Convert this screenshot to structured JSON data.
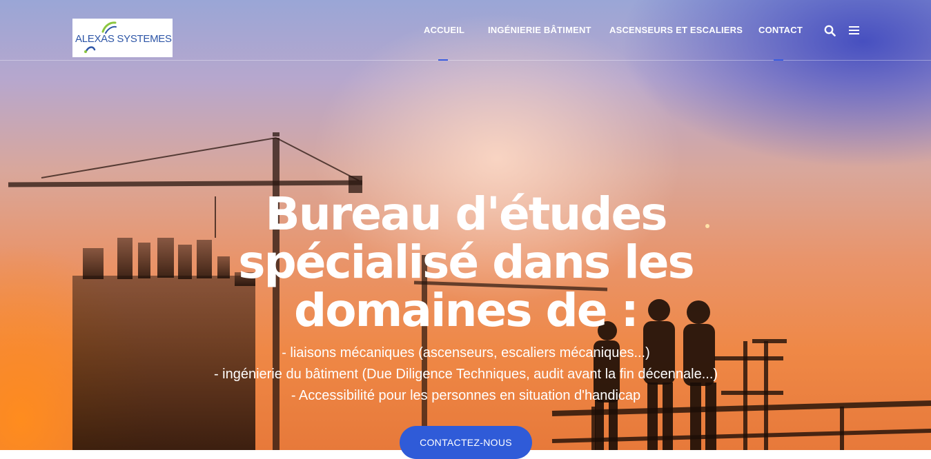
{
  "header": {
    "logo_text": "ALEXAS SYSTEMES",
    "nav": [
      {
        "label": "ACCUEIL",
        "active": true
      },
      {
        "label": "INGÉNIERIE BÂTIMENT",
        "active": false
      },
      {
        "label": "ASCENSEURS ET ESCALIERS",
        "active": false
      },
      {
        "label": "CONTACT",
        "active": false
      }
    ],
    "icons": [
      "search-icon",
      "menu-icon"
    ]
  },
  "hero": {
    "title_lines": [
      "Bureau d'études",
      "spécialisé dans les",
      "domaines de :"
    ],
    "lines": [
      "- liaisons mécaniques (ascenseurs, escaliers mécaniques...)",
      "- ingénierie du bâtiment (Due Diligence Techniques, audit avant la fin décennale...)",
      "- Accessibilité pour les personnes en situation d'handicap"
    ],
    "cta_label": "CONTACTEZ-NOUS"
  },
  "colors": {
    "accent": "#2f5bd8",
    "logo_blue": "#2d55a6",
    "logo_green": "#8cc63f"
  }
}
